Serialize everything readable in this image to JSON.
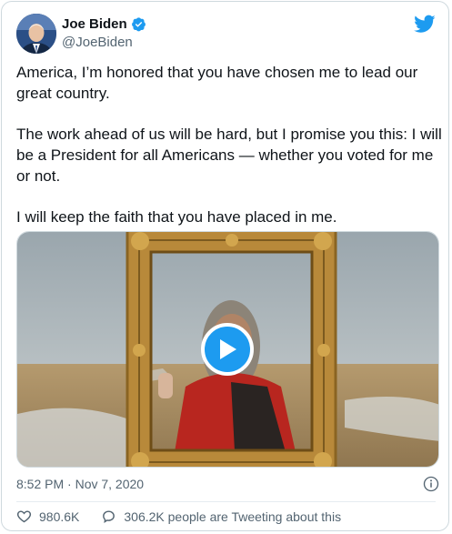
{
  "author": {
    "name": "Joe Biden",
    "handle": "@JoeBiden"
  },
  "tweet": {
    "paragraphs": [
      "America, I’m honored that you have chosen me to lead our great country.",
      "The work ahead of us will be hard, but I promise you this: I will be a President for all Americans — whether you voted for me or not.",
      "I will keep the faith that you have placed in me."
    ],
    "timestamp": "8:52 PM · Nov 7, 2020"
  },
  "stats": {
    "likes": "980.6K",
    "conversation": "306.2K people are Tweeting about this"
  },
  "colors": {
    "accent": "#1d9bf0",
    "secondary_text": "#536471",
    "border": "#cfd9de"
  },
  "icons": {
    "verified": "verified-badge-icon",
    "brand": "twitter-bird-icon",
    "info": "info-icon",
    "like": "heart-icon",
    "reply": "speech-bubble-icon",
    "play": "play-icon"
  }
}
